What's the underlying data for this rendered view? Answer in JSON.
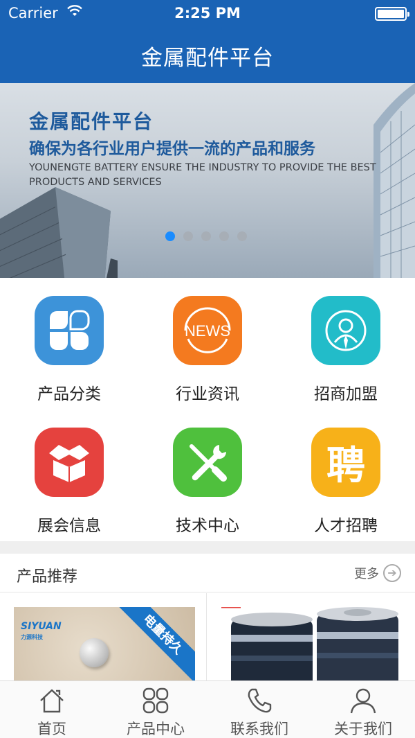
{
  "status_bar": {
    "carrier": "Carrier",
    "time": "2:25 PM"
  },
  "nav": {
    "title": "金属配件平台"
  },
  "banner": {
    "title": "金属配件平台",
    "subtitle": "确保为各行业用户提供一流的产品和服务",
    "english": "YOUNENGTE  BATTERY ENSURE THE INDUSTRY TO PROVIDE THE BEST PRODUCTS AND SERVICES",
    "dots_total": 5,
    "dots_active": 1
  },
  "grid": [
    {
      "label": "产品分类",
      "icon": "category-icon",
      "color": "#3d93d9"
    },
    {
      "label": "行业资讯",
      "icon": "news-icon",
      "color": "#f47a1f",
      "icon_text": "NEWS"
    },
    {
      "label": "招商加盟",
      "icon": "person-icon",
      "color": "#22bcc9"
    },
    {
      "label": "展会信息",
      "icon": "box-icon",
      "color": "#e5423e"
    },
    {
      "label": "技术中心",
      "icon": "tools-icon",
      "color": "#4fc03d"
    },
    {
      "label": "人才招聘",
      "icon": "recruit-icon",
      "color": "#f7b119",
      "icon_text": "聘"
    }
  ],
  "recommend": {
    "title": "产品推荐",
    "more": "更多",
    "products": [
      {
        "ribbon": "电量持久",
        "brand": "SIYUAN",
        "brand_sub": "力源科技"
      },
      {
        "ribbon": ""
      }
    ]
  },
  "tabs": [
    {
      "label": "首页",
      "icon": "home-icon"
    },
    {
      "label": "产品中心",
      "icon": "grid-icon"
    },
    {
      "label": "联系我们",
      "icon": "phone-icon"
    },
    {
      "label": "关于我们",
      "icon": "user-icon"
    }
  ],
  "colors": {
    "nav_bg": "#1a63b5",
    "dot_active": "#1a8cff"
  }
}
